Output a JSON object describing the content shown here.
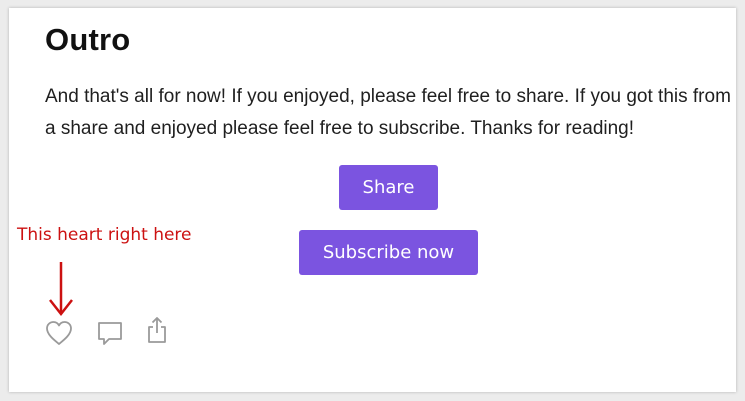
{
  "post": {
    "title": "Outro",
    "body": "And that's all for now! If you enjoyed, please feel free to share. If you got this from a share and enjoyed please feel free to subscribe. Thanks for reading!"
  },
  "buttons": {
    "share_label": "Share",
    "subscribe_label": "Subscribe now"
  },
  "annotation": {
    "text": "This heart right here",
    "color": "#cc1111"
  },
  "actions": {
    "icons": [
      "heart-icon",
      "comment-icon",
      "share-icon"
    ]
  },
  "colors": {
    "accent": "#7b54e0",
    "icon": "#9a9a9a",
    "text": "#1f1f1f"
  }
}
